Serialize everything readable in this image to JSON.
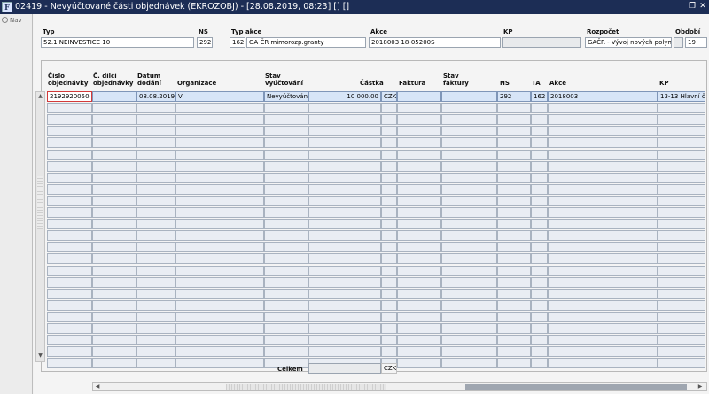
{
  "window": {
    "app_icon_glyph": "F",
    "title": "02419 - Nevyúčtované části objednávek (EKROZOBJ) - [28.08.2019, 08:23] [] []",
    "restore_glyph": "❐",
    "close_glyph": "✕"
  },
  "sidebar": {
    "nav_label": "Nav"
  },
  "header": {
    "typ_label": "Typ",
    "typ_value": "52.1 NEINVESTICE 10",
    "ns_label": "NS",
    "ns_value": "292",
    "typ_akce_label": "Typ akce",
    "typ_akce_code": "162",
    "typ_akce_value": "GA ČR mimorozp.granty",
    "akce_label": "Akce",
    "akce_value": "2018003 18-05200S",
    "kp_label": "KP",
    "kp_value": "",
    "rozpocet_label": "Rozpočet",
    "rozpocet_value": "GAČR - Vývoj nových polym",
    "obdobi_label": "Období",
    "obdobi_value": "19"
  },
  "columns": {
    "cislo_l1": "Číslo",
    "cislo_l2": "objednávky",
    "cdilci_l1": "Č. dílčí",
    "cdilci_l2": "objednávky",
    "datum_l1": "Datum",
    "datum_l2": "dodání",
    "organizace": "Organizace",
    "stav_l1": "Stav",
    "stav_l2": "vyúčtování",
    "castka": "Částka",
    "faktura": "Faktura",
    "stavf_l1": "Stav",
    "stavf_l2": "faktury",
    "ns": "NS",
    "ta": "TA",
    "akce": "Akce",
    "kp": "KP"
  },
  "rows": [
    {
      "cislo": "2192920050",
      "cdilci": "",
      "datum": "08.08.2019",
      "organizace": "V",
      "stav": "Nevyúčtováno",
      "castka": "10 000.00",
      "mena": "CZK",
      "faktura": "",
      "stav_faktury": "",
      "ns": "292",
      "ta": "162",
      "akce": "2018003",
      "kp": "13-13 Hlavní č"
    }
  ],
  "footer": {
    "celkem_label": "Celkem",
    "celkem_value": "",
    "mena": "CZK"
  },
  "scroll": {
    "up": "▲",
    "down": "▼",
    "left": "◀",
    "right": "▶"
  }
}
